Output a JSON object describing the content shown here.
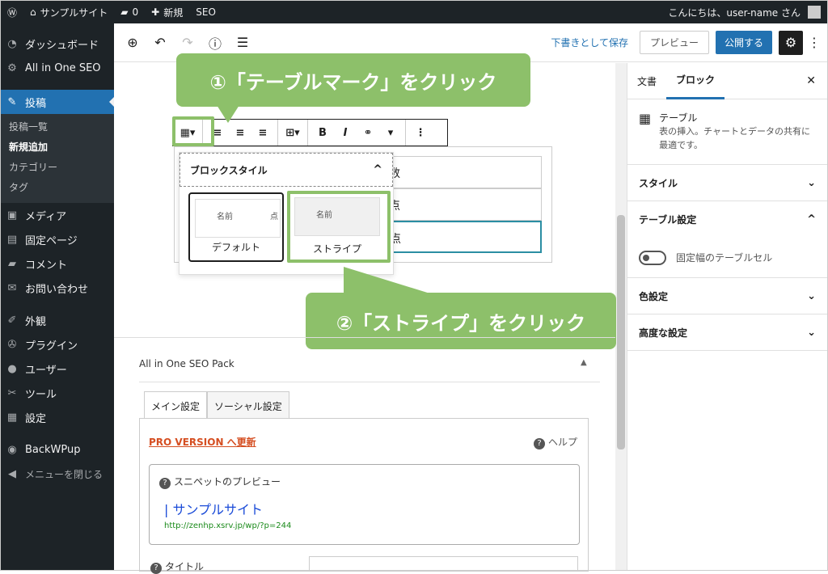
{
  "adminbar": {
    "site": "サンプルサイト",
    "comments": "0",
    "new": "新規",
    "seo": "SEO",
    "greeting": "こんにちは、user-name さん"
  },
  "sidebar": {
    "items": [
      {
        "label": "ダッシュボード"
      },
      {
        "label": "All in One SEO"
      },
      {
        "label": "投稿"
      },
      {
        "label": "メディア"
      },
      {
        "label": "固定ページ"
      },
      {
        "label": "コメント"
      },
      {
        "label": "お問い合わせ"
      },
      {
        "label": "外観"
      },
      {
        "label": "プラグイン"
      },
      {
        "label": "ユーザー"
      },
      {
        "label": "ツール"
      },
      {
        "label": "設定"
      },
      {
        "label": "BackWPup"
      },
      {
        "label": "メニューを閉じる"
      }
    ],
    "sub": [
      "投稿一覧",
      "新規追加",
      "カテゴリー",
      "タグ"
    ]
  },
  "topbar": {
    "draft": "下書きとして保存",
    "preview": "プレビュー",
    "publish": "公開する"
  },
  "block_styles": {
    "title": "ブロックスタイル",
    "default": "デフォルト",
    "stripe": "ストライプ",
    "cell": "名前",
    "cell2": "点"
  },
  "table": {
    "cells": [
      "数",
      "点",
      "点"
    ]
  },
  "callouts": {
    "one": "①「テーブルマーク」をクリック",
    "two": "②「ストライプ」をクリック"
  },
  "panel": {
    "tab_doc": "文書",
    "tab_block": "ブロック",
    "block_name": "テーブル",
    "block_desc": "表の挿入。チャートとデータの共有に最適です。",
    "style": "スタイル",
    "table_settings": "テーブル設定",
    "fixed": "固定幅のテーブルセル",
    "color": "色設定",
    "advanced": "高度な設定"
  },
  "seo": {
    "title": "All in One SEO Pack",
    "tab_main": "メイン設定",
    "tab_social": "ソーシャル設定",
    "pro": "PRO VERSION へ更新",
    "help": "ヘルプ",
    "snippet": "スニペットのプレビュー",
    "site": "| サンプルサイト",
    "url": "http://zenhp.xsrv.jp/wp/?p=244",
    "title_label": "タイトル"
  }
}
